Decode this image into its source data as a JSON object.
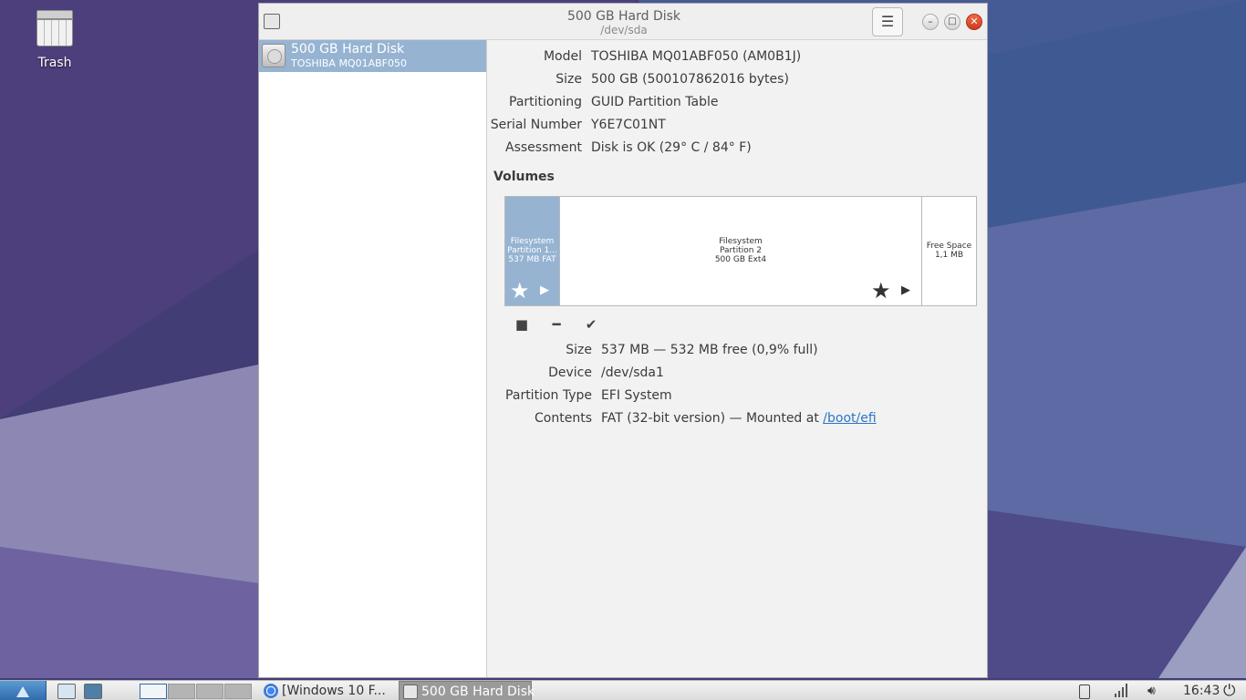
{
  "desktop": {
    "trash_label": "Trash"
  },
  "window": {
    "title": "500 GB Hard Disk",
    "subtitle": "/dev/sda"
  },
  "sidebar": {
    "items": [
      {
        "name": "500 GB Hard Disk",
        "model": "TOSHIBA MQ01ABF050"
      }
    ]
  },
  "drive": {
    "model_label": "Model",
    "model_value": "TOSHIBA MQ01ABF050 (AM0B1J)",
    "size_label": "Size",
    "size_value": "500 GB (500107862016 bytes)",
    "partitioning_label": "Partitioning",
    "partitioning_value": "GUID Partition Table",
    "serial_label": "Serial Number",
    "serial_value": "Y6E7C01NT",
    "assessment_label": "Assessment",
    "assessment_value": "Disk is OK (29° C / 84° F)"
  },
  "volumes": {
    "heading": "Volumes",
    "segments": [
      {
        "line1": "Filesystem",
        "line2": "Partition 1...",
        "line3": "537 MB FAT"
      },
      {
        "line1": "Filesystem",
        "line2": "Partition 2",
        "line3": "500 GB Ext4"
      },
      {
        "line1": "Free Space",
        "line2": "1,1 MB"
      }
    ]
  },
  "partition": {
    "size_label": "Size",
    "size_value": "537 MB — 532 MB free (0,9% full)",
    "device_label": "Device",
    "device_value": "/dev/sda1",
    "type_label": "Partition Type",
    "type_value": "EFI System",
    "contents_label": "Contents",
    "contents_value": "FAT (32-bit version) — Mounted at",
    "mount_link": "/boot/efi"
  },
  "taskbar": {
    "task_chrome": "[Windows 10 F...",
    "task_disks": "500 GB Hard Disk",
    "clock": "16:43"
  },
  "colors": {
    "selection": "#96b4d2",
    "link": "#2a76c6",
    "close_button": "#e0512f"
  }
}
